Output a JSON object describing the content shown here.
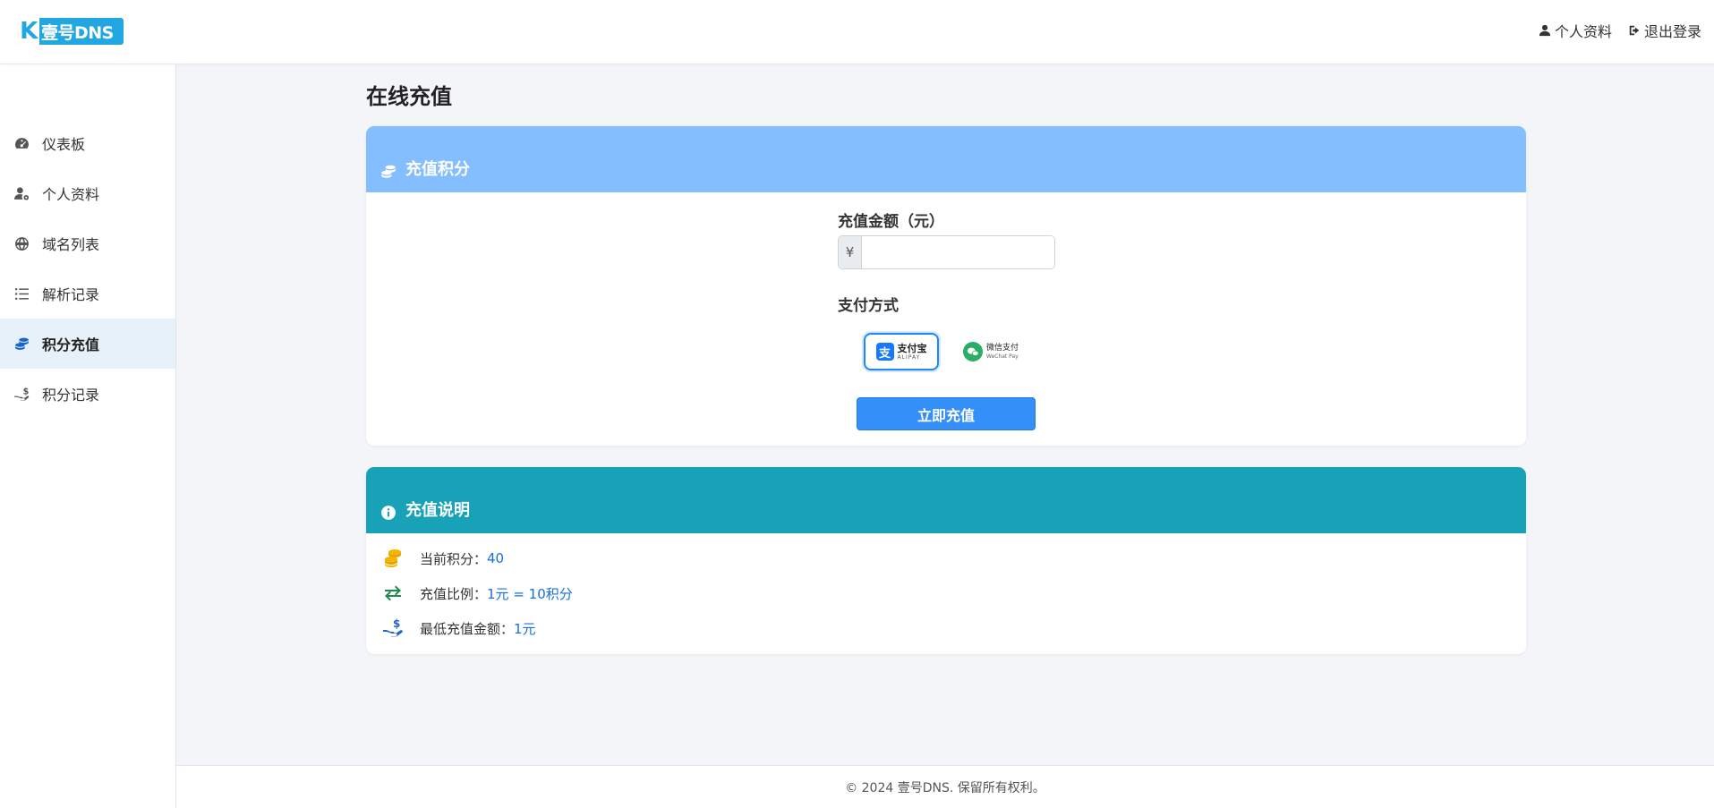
{
  "header": {
    "logo_letter": "K",
    "logo_text": "壹号DNS",
    "profile_link": "个人资料",
    "logout_link": "退出登录"
  },
  "sidebar": {
    "items": [
      {
        "label": "仪表板",
        "icon": "dashboard-icon"
      },
      {
        "label": "个人资料",
        "icon": "user-gear-icon"
      },
      {
        "label": "域名列表",
        "icon": "globe-icon"
      },
      {
        "label": "解析记录",
        "icon": "list-icon"
      },
      {
        "label": "积分充值",
        "icon": "coins-icon",
        "active": true
      },
      {
        "label": "积分记录",
        "icon": "hand-dollar-icon"
      }
    ]
  },
  "main": {
    "title": "在线充值",
    "recharge_card": {
      "title": "充值积分",
      "amount_label": "充值金额（元）",
      "currency_symbol": "¥",
      "amount_value": "",
      "payment_label": "支付方式",
      "payment_options": [
        {
          "cn": "支付宝",
          "en": "ALIPAY",
          "selected": true
        },
        {
          "cn": "微信支付",
          "en": "WeChat Pay",
          "selected": false
        }
      ],
      "submit_label": "立即充值"
    },
    "info_card": {
      "title": "充值说明",
      "rows": [
        {
          "label": "当前积分：",
          "value": "40"
        },
        {
          "label": "充值比例：",
          "value": "1元 = 10积分"
        },
        {
          "label": "最低充值金额：",
          "value": "1元"
        }
      ]
    }
  },
  "footer": {
    "text": "© 2024 壹号DNS. 保留所有权利。"
  },
  "colors": {
    "recharge_header": "#85beff",
    "info_header": "#17a2b8",
    "primary_button": "#3490f8",
    "accent_value": "#1a6fe0"
  }
}
